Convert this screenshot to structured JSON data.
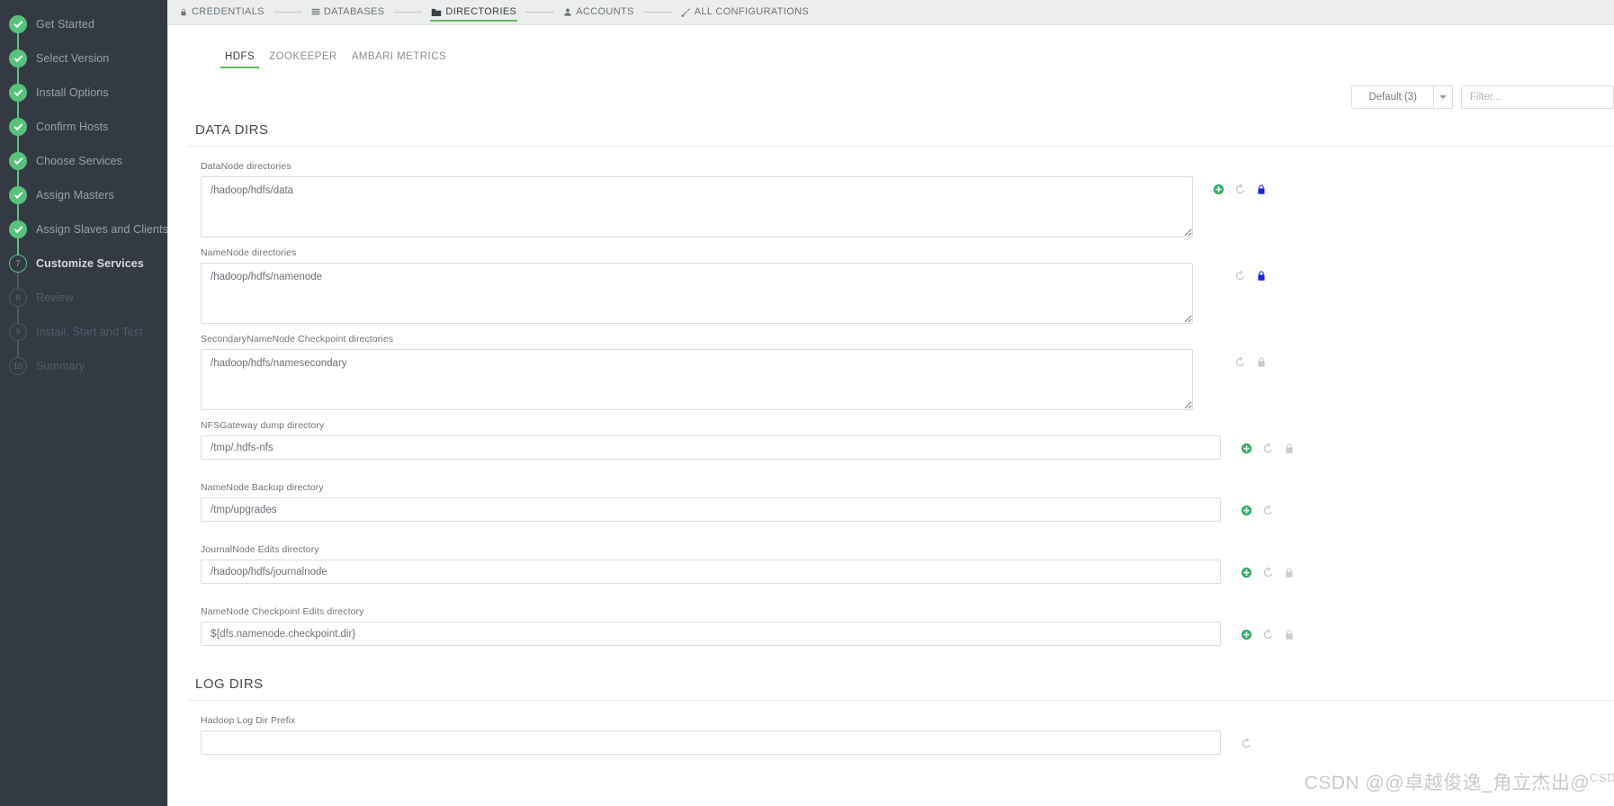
{
  "sidebar": {
    "items": [
      {
        "label": "Get Started",
        "state": "done",
        "badge": "check"
      },
      {
        "label": "Select Version",
        "state": "done",
        "badge": "check"
      },
      {
        "label": "Install Options",
        "state": "done",
        "badge": "check"
      },
      {
        "label": "Confirm Hosts",
        "state": "done",
        "badge": "check"
      },
      {
        "label": "Choose Services",
        "state": "done",
        "badge": "check"
      },
      {
        "label": "Assign Masters",
        "state": "done",
        "badge": "check"
      },
      {
        "label": "Assign Slaves and Clients",
        "state": "done",
        "badge": "check"
      },
      {
        "label": "Customize Services",
        "state": "current",
        "badge": "7"
      },
      {
        "label": "Review",
        "state": "todo",
        "badge": "8"
      },
      {
        "label": "Install, Start and Test",
        "state": "todo",
        "badge": "9"
      },
      {
        "label": "Summary",
        "state": "todo",
        "badge": "10"
      }
    ]
  },
  "topnav": {
    "items": [
      {
        "label": "CREDENTIALS",
        "icon": "lock-icon",
        "active": false
      },
      {
        "label": "DATABASES",
        "icon": "database-icon",
        "active": false
      },
      {
        "label": "DIRECTORIES",
        "icon": "folder-icon",
        "active": true
      },
      {
        "label": "ACCOUNTS",
        "icon": "user-icon",
        "active": false
      },
      {
        "label": "ALL CONFIGURATIONS",
        "icon": "wrench-icon",
        "active": false
      }
    ]
  },
  "subtabs": [
    {
      "label": "HDFS",
      "active": true
    },
    {
      "label": "ZOOKEEPER",
      "active": false
    },
    {
      "label": "AMBARI METRICS",
      "active": false
    }
  ],
  "toolbar": {
    "config_group_label": "Default (3)",
    "filter_placeholder": "Filter..."
  },
  "sections": [
    {
      "title": "DATA DIRS",
      "fields": [
        {
          "label": "DataNode directories",
          "value": "/hadoop/hdfs/data",
          "type": "textarea",
          "icons": [
            "plus-icon",
            "revert-icon",
            "lock-closed-icon"
          ],
          "lock_state": "locked"
        },
        {
          "label": "NameNode directories",
          "value": "/hadoop/hdfs/namenode",
          "type": "textarea",
          "icons": [
            "revert-icon",
            "lock-closed-icon"
          ],
          "lock_state": "locked"
        },
        {
          "label": "SecondaryNameNode Checkpoint directories",
          "value": "/hadoop/hdfs/namesecondary",
          "type": "textarea",
          "icons": [
            "revert-icon",
            "lock-open-icon"
          ],
          "lock_state": "unlocked"
        },
        {
          "label": "NFSGateway dump directory",
          "value": "/tmp/.hdfs-nfs",
          "type": "input",
          "icons": [
            "plus-icon",
            "revert-icon",
            "lock-open-icon"
          ],
          "lock_state": "unlocked"
        },
        {
          "label": "NameNode Backup directory",
          "value": "/tmp/upgrades",
          "type": "input",
          "icons": [
            "plus-icon",
            "revert-icon"
          ],
          "lock_state": "none"
        },
        {
          "label": "JournalNode Edits directory",
          "value": "/hadoop/hdfs/journalnode",
          "type": "input",
          "icons": [
            "plus-icon",
            "revert-icon",
            "lock-open-icon"
          ],
          "lock_state": "unlocked"
        },
        {
          "label": "NameNode Checkpoint Edits directory",
          "value": "${dfs.namenode.checkpoint.dir}",
          "type": "input",
          "icons": [
            "plus-icon",
            "revert-icon",
            "lock-open-icon"
          ],
          "lock_state": "unlocked"
        }
      ]
    },
    {
      "title": "LOG DIRS",
      "fields": [
        {
          "label": "Hadoop Log Dir Prefix",
          "value": "",
          "type": "input",
          "icons": [
            "revert-icon"
          ],
          "lock_state": "none"
        }
      ]
    }
  ],
  "watermark": {
    "main": "CSDN @@卓越俊逸_角立杰出@",
    "suffix": "CSDN"
  },
  "colors": {
    "sidebar_bg": "#343a44",
    "accent_green": "#63b963",
    "done_green": "#58c27d",
    "lock_blue": "#2020e0",
    "page_bg": "#eceded"
  }
}
